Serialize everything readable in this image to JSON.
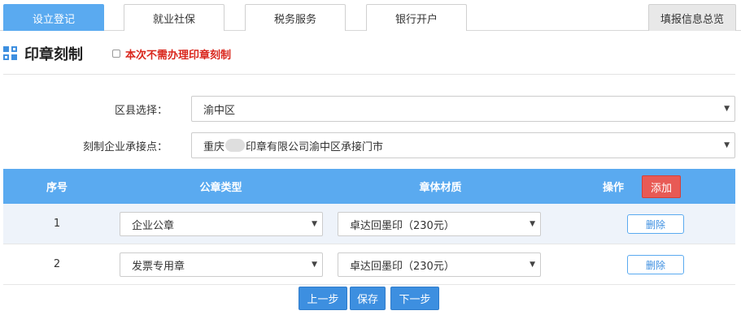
{
  "tabs": [
    {
      "label": "设立登记",
      "active": true
    },
    {
      "label": "就业社保",
      "active": false
    },
    {
      "label": "税务服务",
      "active": false
    },
    {
      "label": "银行开户",
      "active": false
    }
  ],
  "summary_tab": "填报信息总览",
  "section": {
    "title": "印章刻制",
    "skip_label": "本次不需办理印章刻制",
    "skip_checked": false
  },
  "form": {
    "district_label": "区县选择：",
    "district_value": "渝中区",
    "engraver_label": "刻制企业承接点：",
    "engraver_value_prefix": "重庆",
    "engraver_value_suffix": "印章有限公司渝中区承接门市"
  },
  "table": {
    "headers": {
      "index": "序号",
      "type": "公章类型",
      "material": "章体材质",
      "action": "操作"
    },
    "add_label": "添加",
    "rows": [
      {
        "index": "1",
        "type": "企业公章",
        "material": "卓达回墨印（230元）",
        "delete_label": "删除"
      },
      {
        "index": "2",
        "type": "发票专用章",
        "material": "卓达回墨印（230元）",
        "delete_label": "删除"
      }
    ]
  },
  "footer": {
    "prev_label": "上一步",
    "save_label": "保存",
    "next_label": "下一步"
  },
  "colors": {
    "accent": "#5aaaf0",
    "danger": "#e85a55",
    "warning_text": "#d9261c"
  }
}
